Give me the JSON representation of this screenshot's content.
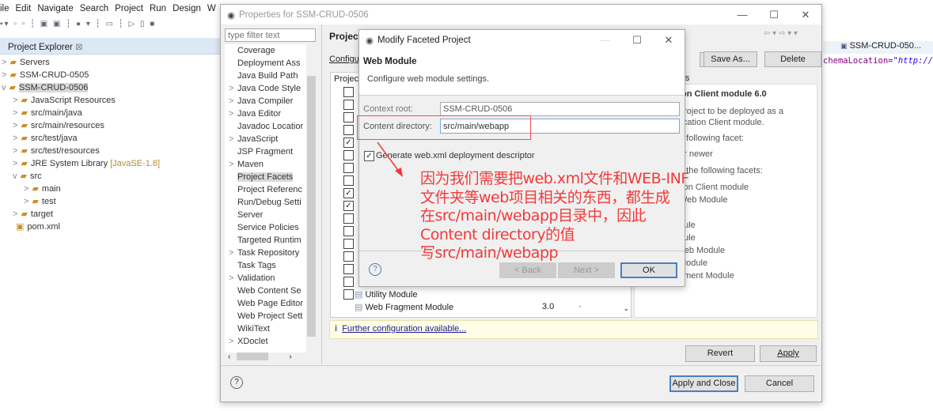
{
  "menu": [
    "ile",
    "Edit",
    "Navigate",
    "Search",
    "Project",
    "Run",
    "Design",
    "W"
  ],
  "explorer": {
    "title": "Project Explorer",
    "tree": [
      {
        "label": "Servers",
        "depth": 0,
        "arrow": ">"
      },
      {
        "label": "SSM-CRUD-0505",
        "depth": 0,
        "arrow": ">"
      },
      {
        "label": "SSM-CRUD-0506",
        "depth": 0,
        "arrow": "v",
        "selected": true
      },
      {
        "label": "JavaScript Resources",
        "depth": 1,
        "arrow": ">"
      },
      {
        "label": "src/main/java",
        "depth": 1,
        "arrow": ">"
      },
      {
        "label": "src/main/resources",
        "depth": 1,
        "arrow": ">"
      },
      {
        "label": "src/test/java",
        "depth": 1,
        "arrow": ">"
      },
      {
        "label": "src/test/resources",
        "depth": 1,
        "arrow": ">"
      },
      {
        "label": "JRE System Library",
        "suffix": "[JavaSE-1.8]",
        "depth": 1,
        "arrow": ">"
      },
      {
        "label": "src",
        "depth": 1,
        "arrow": "v"
      },
      {
        "label": "main",
        "depth": 2,
        "arrow": ">"
      },
      {
        "label": "test",
        "depth": 2,
        "arrow": ">"
      },
      {
        "label": "target",
        "depth": 1,
        "arrow": ">"
      },
      {
        "label": "pom.xml",
        "depth": 1,
        "arrow": ""
      }
    ]
  },
  "editor": {
    "tab": "SSM-CRUD-050...",
    "line_attr": "chemaLocation=",
    "line_value": "\"http://r"
  },
  "properties": {
    "title": "Properties for SSM-CRUD-0506",
    "filter_placeholder": "type filter text",
    "nav": [
      {
        "label": "Coverage",
        "arrow": ""
      },
      {
        "label": "Deployment Ass",
        "arrow": ""
      },
      {
        "label": "Java Build Path",
        "arrow": ""
      },
      {
        "label": "Java Code Style",
        "arrow": ">"
      },
      {
        "label": "Java Compiler",
        "arrow": ">"
      },
      {
        "label": "Java Editor",
        "arrow": ">"
      },
      {
        "label": "Javadoc Locatior",
        "arrow": ""
      },
      {
        "label": "JavaScript",
        "arrow": ">"
      },
      {
        "label": "JSP Fragment",
        "arrow": ""
      },
      {
        "label": "Maven",
        "arrow": ">"
      },
      {
        "label": "Project Facets",
        "arrow": "",
        "selected": true
      },
      {
        "label": "Project Referenc",
        "arrow": ""
      },
      {
        "label": "Run/Debug Setti",
        "arrow": ""
      },
      {
        "label": "Server",
        "arrow": ""
      },
      {
        "label": "Service Policies",
        "arrow": ""
      },
      {
        "label": "Targeted Runtim",
        "arrow": ""
      },
      {
        "label": "Task Repository",
        "arrow": ">"
      },
      {
        "label": "Task Tags",
        "arrow": ""
      },
      {
        "label": "Validation",
        "arrow": ">"
      },
      {
        "label": "Web Content Se",
        "arrow": ""
      },
      {
        "label": "Web Page Editor",
        "arrow": ""
      },
      {
        "label": "Web Project Sett",
        "arrow": ""
      },
      {
        "label": "WikiText",
        "arrow": ""
      },
      {
        "label": "XDoclet",
        "arrow": ">"
      }
    ],
    "page_title": "Project",
    "config_label": "Configu",
    "save_as": "Save As...",
    "delete": "Delete",
    "table_header": "Projec",
    "runtimes_tab": "ntimes",
    "checked_rows": [
      false,
      false,
      false,
      false,
      true,
      false,
      false,
      false,
      true,
      true,
      false,
      false,
      false,
      false,
      false,
      false,
      false
    ],
    "facets": [
      {
        "name": "Utility Module",
        "version": ""
      },
      {
        "name": "Web Fragment Module",
        "version": "3.0"
      }
    ],
    "details": [
      "ion Client module 6.0",
      " project to be deployed as a",
      "lication Client module.",
      "e following facet:",
      " or newer",
      "h the following facets:",
      "tion Client module",
      " Web Module",
      "",
      "dule",
      "dule",
      "Veb Module",
      "Module",
      "gment Module"
    ],
    "info_link": "Further configuration available...",
    "revert": "Revert",
    "apply": "Apply",
    "apply_close": "Apply and Close",
    "cancel": "Cancel"
  },
  "modal": {
    "title": "Modify Faceted Project",
    "heading": "Web Module",
    "description": "Configure web module settings.",
    "context_root_label": "Context root:",
    "context_root_value": "SSM-CRUD-0506",
    "content_dir_label": "Content directory:",
    "content_dir_value": "src/main/webapp",
    "generate_label": "Generate web.xml deployment descriptor",
    "generate_checked": true,
    "back": "< Back",
    "next": "Next >",
    "ok": "OK"
  },
  "annotation": {
    "lines": [
      "因为我们需要把web.xml文件和WEB-INF",
      "文件夹等web项目相关的东西，都生成",
      "在src/main/webapp目录中，因此",
      "Content directory的值",
      "写src/main/webapp"
    ],
    "color": "#f23a3a"
  }
}
